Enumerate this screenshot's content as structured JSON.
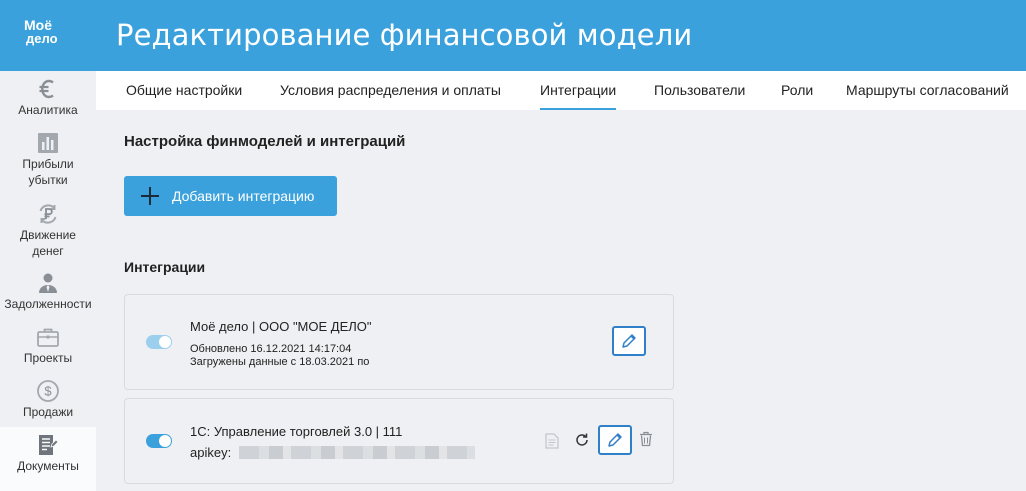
{
  "logo": {
    "line1": "Моё",
    "line2": "дело"
  },
  "header": {
    "title": "Редактирование финансовой модели"
  },
  "sidebar": {
    "items": [
      {
        "label": "Аналитика",
        "icon": "euro-icon"
      },
      {
        "label": "Прибыли\nубытки",
        "icon": "bar-chart-icon"
      },
      {
        "label": "Движение\nденег",
        "icon": "ruble-cycle-icon"
      },
      {
        "label": "Задолженности",
        "icon": "person-icon"
      },
      {
        "label": "Проекты",
        "icon": "briefcase-icon"
      },
      {
        "label": "Продажи",
        "icon": "dollar-icon"
      },
      {
        "label": "Документы",
        "icon": "document-icon",
        "active": true
      }
    ]
  },
  "tabs": [
    {
      "label": "Общие настройки"
    },
    {
      "label": "Условия распределения и оплаты"
    },
    {
      "label": "Интеграции",
      "active": true
    },
    {
      "label": "Пользователи"
    },
    {
      "label": "Роли"
    },
    {
      "label": "Маршруты согласований"
    }
  ],
  "main": {
    "section_title": "Настройка финмоделей и интеграций",
    "add_button": "Добавить интеграцию",
    "integrations_title": "Интеграции",
    "cards": [
      {
        "name": "Моё дело | ООО \"МОЕ ДЕЛО\"",
        "updated": "Обновлено 16.12.2021 14:17:04",
        "loaded": "Загружены данные с 18.03.2021 по",
        "enabled": true
      },
      {
        "name": "1С: Управление торговлей 3.0 | 111",
        "apikey_label": "apikey:",
        "enabled": true
      }
    ]
  },
  "colors": {
    "accent": "#3aa1dc",
    "edit_border": "#2f80c9",
    "background": "#eef0f3"
  }
}
